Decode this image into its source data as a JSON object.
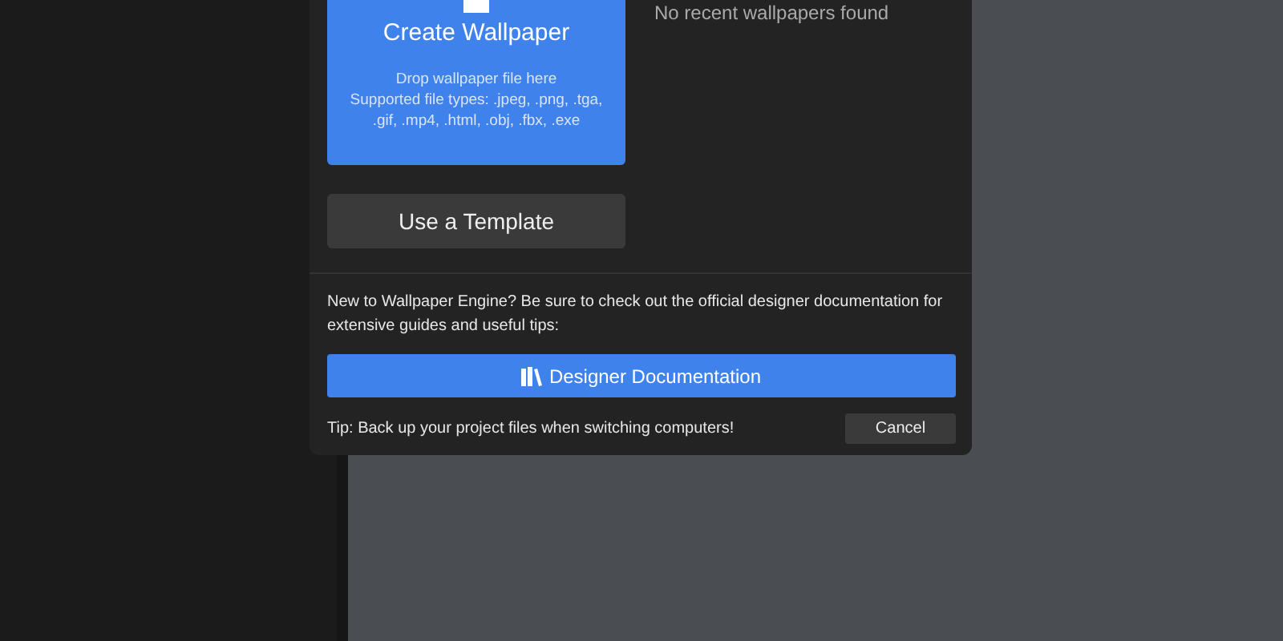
{
  "dialog": {
    "create_card": {
      "title": "Create Wallpaper",
      "hint": "Drop wallpaper file here",
      "file_types": "Supported file types: .jpeg, .png, .tga, .gif, .mp4, .html, .obj, .fbx, .exe"
    },
    "recent": {
      "empty_text": "No recent wallpapers found"
    },
    "template_button": "Use a Template",
    "intro": "New to Wallpaper Engine? Be sure to check out the official designer documentation for extensive guides and useful tips:",
    "docs_button": "Designer Documentation",
    "tip": "Tip: Back up your project files when switching computers!",
    "cancel_button": "Cancel"
  }
}
